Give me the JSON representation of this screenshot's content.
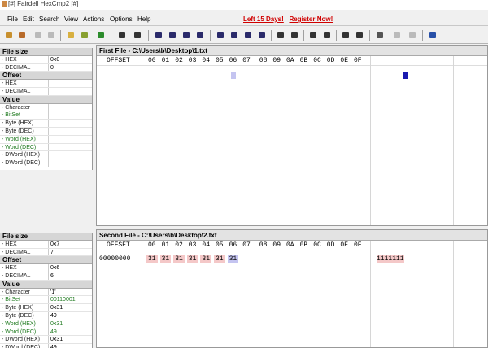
{
  "window": {
    "title": "[#] Fairdell HexCmp2 [#]"
  },
  "menu": [
    "File",
    "Edit",
    "Search",
    "View",
    "Actions",
    "Options",
    "Help"
  ],
  "promo": {
    "days": "Left 15 Days!",
    "register": "Register Now!"
  },
  "colors": {
    "accent": "#d00000",
    "green_label": "#1f7a1f",
    "highlight": "#f4c8c8"
  },
  "toolbar": {
    "icons": [
      "open-icon",
      "open-second-icon",
      "stop-icon",
      "stop-icon",
      "compare-left-icon",
      "compare-right-icon",
      "refresh-icon",
      "binoculars-icon",
      "find-icon",
      "first-diff-icon",
      "prev-diff-icon",
      "next-diff-icon",
      "last-diff-icon",
      "first-block-icon",
      "prev-block-icon",
      "next-block-icon",
      "last-block-icon",
      "sync-icon",
      "sync-right-icon",
      "left-align-icon",
      "right-align-icon",
      "bytes-icon",
      "lines-icon",
      "print-icon",
      "settings-icon",
      "settings-alt-icon",
      "help-icon"
    ]
  },
  "panel1": {
    "rows": [
      {
        "type": "hdr",
        "label": "File size"
      },
      {
        "label": "- HEX",
        "value": "0x0"
      },
      {
        "label": "- DECIMAL",
        "value": "0"
      },
      {
        "type": "hdr",
        "label": "Offset"
      },
      {
        "label": "- HEX",
        "value": ""
      },
      {
        "label": "- DECIMAL",
        "value": ""
      },
      {
        "type": "hdr",
        "label": "Value"
      },
      {
        "label": "- Character",
        "value": ""
      },
      {
        "label": "- BitSet",
        "value": "",
        "green": true
      },
      {
        "label": "- Byte (HEX)",
        "value": ""
      },
      {
        "label": "- Byte (DEC)",
        "value": ""
      },
      {
        "label": "- Word (HEX)",
        "value": "",
        "green": true
      },
      {
        "label": "- Word (DEC)",
        "value": "",
        "green": true
      },
      {
        "label": "- DWord (HEX)",
        "value": ""
      },
      {
        "label": "- DWord (DEC)",
        "value": ""
      }
    ]
  },
  "panel2": {
    "rows": [
      {
        "type": "hdr",
        "label": "File size"
      },
      {
        "label": "- HEX",
        "value": "0x7"
      },
      {
        "label": "- DECIMAL",
        "value": "7"
      },
      {
        "type": "hdr",
        "label": "Offset"
      },
      {
        "label": "- HEX",
        "value": "0x6"
      },
      {
        "label": "- DECIMAL",
        "value": "6"
      },
      {
        "type": "hdr",
        "label": "Value"
      },
      {
        "label": "- Character",
        "value": "'1'"
      },
      {
        "label": "- BitSet",
        "value": "00110001",
        "green": true
      },
      {
        "label": "- Byte (HEX)",
        "value": "0x31"
      },
      {
        "label": "- Byte (DEC)",
        "value": "49"
      },
      {
        "label": "- Word (HEX)",
        "value": "0x31",
        "green": true
      },
      {
        "label": "- Word (DEC)",
        "value": "49",
        "green": true
      },
      {
        "label": "- DWord (HEX)",
        "value": "0x31"
      },
      {
        "label": "- DWord (DEC)",
        "value": "49"
      }
    ]
  },
  "pane1": {
    "title": "First File - C:\\Users\\b\\Desktop\\1.txt",
    "offset_header": "OFFSET",
    "columns": [
      "00",
      "01",
      "02",
      "03",
      "04",
      "05",
      "06",
      "07",
      "08",
      "09",
      "0A",
      "0B",
      "0C",
      "0D",
      "0E",
      "0F"
    ],
    "rows": []
  },
  "pane2": {
    "title": "Second File - C:\\Users\\b\\Desktop\\2.txt",
    "offset_header": "OFFSET",
    "columns": [
      "00",
      "01",
      "02",
      "03",
      "04",
      "05",
      "06",
      "07",
      "08",
      "09",
      "0A",
      "0B",
      "0C",
      "0D",
      "0E",
      "0F"
    ],
    "rows": [
      {
        "offset": "00000000",
        "bytes": [
          "31",
          "31",
          "31",
          "31",
          "31",
          "31",
          "31"
        ],
        "ascii": "1111111"
      }
    ]
  }
}
